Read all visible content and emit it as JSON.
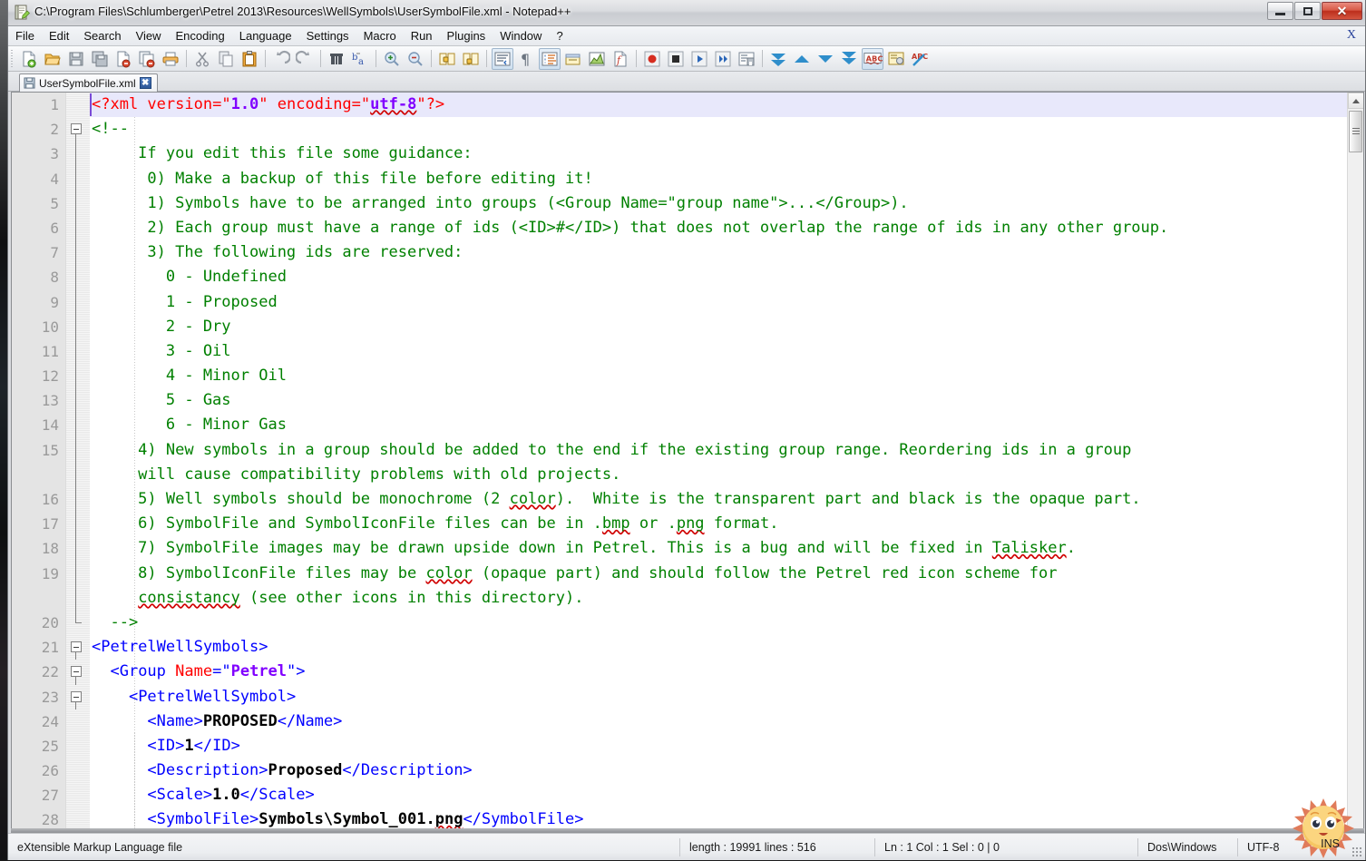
{
  "window": {
    "title": "C:\\Program Files\\Schlumberger\\Petrel 2013\\Resources\\WellSymbols\\UserSymbolFile.xml - Notepad++",
    "icon_name": "notepad-plus-plus-icon",
    "minimize_label": "Minimize",
    "maximize_label": "Restore",
    "close_label": "Close",
    "close_glyph": "✕"
  },
  "menubar": {
    "items": [
      {
        "label": "File"
      },
      {
        "label": "Edit"
      },
      {
        "label": "Search"
      },
      {
        "label": "View"
      },
      {
        "label": "Encoding"
      },
      {
        "label": "Language"
      },
      {
        "label": "Settings"
      },
      {
        "label": "Macro"
      },
      {
        "label": "Run"
      },
      {
        "label": "Plugins"
      },
      {
        "label": "Window"
      },
      {
        "label": "?"
      }
    ],
    "doc_close_label": "X"
  },
  "toolbar": {
    "buttons": [
      {
        "name": "new-file-icon",
        "title": "New"
      },
      {
        "name": "open-file-icon",
        "title": "Open"
      },
      {
        "name": "save-icon",
        "title": "Save"
      },
      {
        "name": "save-all-icon",
        "title": "Save All"
      },
      {
        "name": "close-file-icon",
        "title": "Close"
      },
      {
        "name": "close-all-files-icon",
        "title": "Close All"
      },
      {
        "name": "print-icon",
        "title": "Print"
      },
      {
        "name": "separator"
      },
      {
        "name": "cut-icon",
        "title": "Cut"
      },
      {
        "name": "copy-icon",
        "title": "Copy"
      },
      {
        "name": "paste-icon",
        "title": "Paste"
      },
      {
        "name": "separator"
      },
      {
        "name": "undo-icon",
        "title": "Undo"
      },
      {
        "name": "redo-icon",
        "title": "Redo"
      },
      {
        "name": "separator"
      },
      {
        "name": "find-icon",
        "title": "Find"
      },
      {
        "name": "replace-icon",
        "title": "Replace"
      },
      {
        "name": "separator"
      },
      {
        "name": "zoom-in-icon",
        "title": "Zoom In"
      },
      {
        "name": "zoom-out-icon",
        "title": "Zoom Out"
      },
      {
        "name": "separator"
      },
      {
        "name": "sync-vertical-scroll-icon",
        "title": "Synchronize Vertical Scrolling"
      },
      {
        "name": "sync-horizontal-scroll-icon",
        "title": "Synchronize Horizontal Scrolling"
      },
      {
        "name": "separator"
      },
      {
        "name": "word-wrap-icon",
        "title": "Word Wrap"
      },
      {
        "name": "show-all-characters-icon",
        "title": "Show All Characters"
      },
      {
        "name": "indent-guide-icon",
        "title": "Show Indent Guide"
      },
      {
        "name": "user-defined-dialog-icon",
        "title": "User Defined Dialogue"
      },
      {
        "name": "document-map-icon",
        "title": "Document Map"
      },
      {
        "name": "function-list-icon",
        "title": "Function List"
      },
      {
        "name": "separator"
      },
      {
        "name": "start-record-macro-icon",
        "title": "Start Recording"
      },
      {
        "name": "stop-record-macro-icon",
        "title": "Stop Recording"
      },
      {
        "name": "play-macro-icon",
        "title": "Playback"
      },
      {
        "name": "run-macro-multiple-icon",
        "title": "Run a Macro Multiple Times"
      },
      {
        "name": "save-macro-icon",
        "title": "Save Current Recorded Macro"
      },
      {
        "name": "separator"
      },
      {
        "name": "first-bookmark-icon",
        "title": "First Bookmark"
      },
      {
        "name": "previous-bookmark-icon",
        "title": "Previous Bookmark"
      },
      {
        "name": "next-bookmark-icon",
        "title": "Next Bookmark"
      },
      {
        "name": "last-bookmark-icon",
        "title": "Last Bookmark"
      },
      {
        "name": "spell-check-icon",
        "title": "Spell Check"
      },
      {
        "name": "compare-icon",
        "title": "Compare"
      },
      {
        "name": "check-spelling-icon",
        "title": "Check Spelling"
      }
    ]
  },
  "tabs": [
    {
      "label": "UserSymbolFile.xml",
      "save_icon": "floppy-save-icon",
      "close_glyph": "✖",
      "active": true
    }
  ],
  "editor": {
    "current_line": 1,
    "lines": [
      {
        "n": "1",
        "fold": "none",
        "current": true,
        "html": "<span class=\"pi\">&lt;?xml </span><span class=\"at\">version</span><span class=\"pi\">=</span><span class=\"pi\">\"</span><span class=\"av\">1.0</span><span class=\"pi\">\" </span><span class=\"at\">encoding</span><span class=\"pi\">=</span><span class=\"pi\">\"</span><span class=\"av sp\">utf-8</span><span class=\"pi\">\"?&gt;</span>"
      },
      {
        "n": "2",
        "fold": "open",
        "html": "<span class=\"cm\">&lt;!--</span>"
      },
      {
        "n": "3",
        "fold": "line",
        "html": "<span class=\"cm\">     If you edit this file some guidance:</span>"
      },
      {
        "n": "4",
        "fold": "line",
        "html": "<span class=\"cm\">      0) Make a backup of this file before editing it!</span>"
      },
      {
        "n": "5",
        "fold": "line",
        "html": "<span class=\"cm\">      1) Symbols have to be arranged into groups (&lt;Group Name=\"group name\"&gt;...&lt;/Group&gt;).</span>"
      },
      {
        "n": "6",
        "fold": "line",
        "html": "<span class=\"cm\">      2) Each group must have a range of ids (&lt;ID&gt;#&lt;/ID&gt;) that does not overlap the range of ids in any other group.</span>"
      },
      {
        "n": "7",
        "fold": "line",
        "html": "<span class=\"cm\">      3) The following ids are reserved:</span>"
      },
      {
        "n": "8",
        "fold": "line",
        "html": "<span class=\"cm\">        0 - Undefined</span>"
      },
      {
        "n": "9",
        "fold": "line",
        "html": "<span class=\"cm\">        1 - Proposed</span>"
      },
      {
        "n": "10",
        "fold": "line",
        "html": "<span class=\"cm\">        2 - Dry</span>"
      },
      {
        "n": "11",
        "fold": "line",
        "html": "<span class=\"cm\">        3 - Oil</span>"
      },
      {
        "n": "12",
        "fold": "line",
        "html": "<span class=\"cm\">        4 - Minor Oil</span>"
      },
      {
        "n": "13",
        "fold": "line",
        "html": "<span class=\"cm\">        5 - Gas</span>"
      },
      {
        "n": "14",
        "fold": "line",
        "html": "<span class=\"cm\">        6 - Minor Gas</span>"
      },
      {
        "n": "15",
        "fold": "line",
        "html": "<span class=\"cm\">     4) New symbols in a group should be added to the end if the existing group range. Reordering ids in a group</span>"
      },
      {
        "n": "",
        "fold": "line",
        "html": "<span class=\"cm\">     will cause compatibility problems with old projects.</span>"
      },
      {
        "n": "16",
        "fold": "line",
        "html": "<span class=\"cm\">     5) Well symbols should be monochrome (2 <span class=\"sp\">color</span>).  White is the transparent part and black is the opaque part.</span>"
      },
      {
        "n": "17",
        "fold": "line",
        "html": "<span class=\"cm\">     6) SymbolFile and SymbolIconFile files can be in .<span class=\"sp\">bmp</span> or .<span class=\"sp\">png</span> format.</span>"
      },
      {
        "n": "18",
        "fold": "line",
        "html": "<span class=\"cm\">     7) SymbolFile images may be drawn upside down in Petrel. This is a bug and will be fixed in <span class=\"sp\">Talisker</span>.</span>"
      },
      {
        "n": "19",
        "fold": "line",
        "html": "<span class=\"cm\">     8) SymbolIconFile files may be <span class=\"sp\">color</span> (opaque part) and should follow the Petrel red icon scheme for</span>"
      },
      {
        "n": "",
        "fold": "line",
        "html": "<span class=\"cm\">     <span class=\"sp\">consistancy</span> (see other icons in this directory).</span>"
      },
      {
        "n": "20",
        "fold": "end",
        "html": "<span class=\"cm\">  --&gt;</span>"
      },
      {
        "n": "21",
        "fold": "open",
        "html": "<span class=\"tg\">&lt;PetrelWellSymbols&gt;</span>"
      },
      {
        "n": "22",
        "fold": "open2",
        "html": "  <span class=\"tg\">&lt;Group </span><span class=\"at\">Name</span><span class=\"tg\">=</span><span class=\"tg\">\"</span><span class=\"av\">Petrel</span><span class=\"tg\">\"&gt;</span>"
      },
      {
        "n": "23",
        "fold": "open3",
        "html": "    <span class=\"tg\">&lt;PetrelWellSymbol&gt;</span>"
      },
      {
        "n": "24",
        "fold": "none",
        "html": "      <span class=\"tg\">&lt;Name&gt;</span><span class=\"tx\">PROPOSED</span><span class=\"tg\">&lt;/Name&gt;</span>"
      },
      {
        "n": "25",
        "fold": "none",
        "html": "      <span class=\"tg\">&lt;ID&gt;</span><span class=\"tx\">1</span><span class=\"tg\">&lt;/ID&gt;</span>"
      },
      {
        "n": "26",
        "fold": "none",
        "html": "      <span class=\"tg\">&lt;Description&gt;</span><span class=\"tx\">Proposed</span><span class=\"tg\">&lt;/Description&gt;</span>"
      },
      {
        "n": "27",
        "fold": "none",
        "html": "      <span class=\"tg\">&lt;Scale&gt;</span><span class=\"tx\">1.0</span><span class=\"tg\">&lt;/Scale&gt;</span>"
      },
      {
        "n": "28",
        "fold": "none",
        "html": "      <span class=\"tg\">&lt;SymbolFile&gt;</span><span class=\"tx\">Symbols\\Symbol_001.<span class=\"sp\">png</span></span><span class=\"tg\">&lt;/SymbolFile&gt;</span>"
      }
    ]
  },
  "statusbar": {
    "doc_type": "eXtensible Markup Language file",
    "length_lines": "length : 19991   lines : 516",
    "caret": "Ln : 1    Col : 1    Sel : 0 | 0",
    "eol": "Dos\\Windows",
    "encoding": "UTF-8",
    "insert_mode": "INS",
    "mascot_icon": "sun-mascot-icon"
  },
  "colors": {
    "tag": "#0000ff",
    "attribute": "#ff0000",
    "value": "#8000ff",
    "comment": "#008000",
    "text": "#000000",
    "spellcheck_underline": "#d00000",
    "current_line_bg": "#e8e8fb",
    "close_button": "#bc2e1c"
  }
}
